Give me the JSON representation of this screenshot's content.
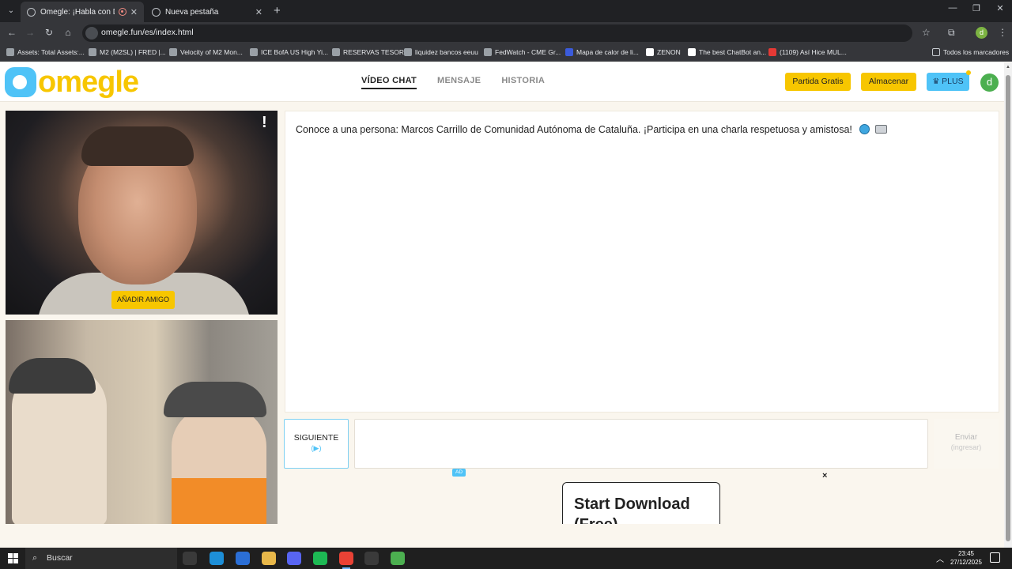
{
  "browser": {
    "tabs": [
      {
        "label": "Omegle: ¡Habla con Desconocidos!",
        "active": true
      },
      {
        "label": "Nueva pestaña",
        "active": false
      }
    ],
    "url": "omegle.fun/es/index.html",
    "profile_initial": "d",
    "bookmarks": [
      {
        "label": "Assets: Total Assets:..."
      },
      {
        "label": "M2 (M2SL) | FRED |..."
      },
      {
        "label": "Velocity of M2 Mon..."
      },
      {
        "label": "ICE BofA US High Yi..."
      },
      {
        "label": "RESERVAS TESORO"
      },
      {
        "label": "liquidez bancos eeuu"
      },
      {
        "label": "FedWatch - CME Gr..."
      },
      {
        "label": "Mapa de calor de li..."
      },
      {
        "label": "ZENON"
      },
      {
        "label": "The best ChatBot an..."
      },
      {
        "label": "(1109) Así Hice MUL..."
      }
    ],
    "all_bookmarks_label": "Todos los marcadores"
  },
  "site": {
    "logo_text": "omegle",
    "nav": [
      {
        "label": "VÍDEO CHAT",
        "active": true
      },
      {
        "label": "MENSAJE",
        "active": false
      },
      {
        "label": "HISTORIA",
        "active": false
      }
    ],
    "buttons": {
      "free_match": "Partida Gratis",
      "store": "Almacenar",
      "plus": "PLUS"
    },
    "user_initial": "d"
  },
  "video": {
    "report_glyph": "!",
    "add_friend": "AÑADIR AMIGO"
  },
  "chat": {
    "message": "Conoce a una persona: Marcos Carrillo de Comunidad Autónoma de Cataluña. ¡Participa en una charla respetuosa y amistosa!",
    "next_label": "SIGUIENTE",
    "next_hint": "(▶)",
    "input_value": "",
    "send_label": "Enviar",
    "send_hint": "(ingresar)"
  },
  "ad": {
    "badge": "AD",
    "close": "×",
    "title": "Start Download",
    "subtitle": "(Free)"
  },
  "taskbar": {
    "search_label": "Buscar",
    "time": "23:45",
    "date": "27/12/2025",
    "apps": [
      {
        "name": "task-view-icon",
        "color": "#3a3a3a"
      },
      {
        "name": "edge-icon",
        "color": "#1d8fd8"
      },
      {
        "name": "store-icon",
        "color": "#2b6fd6"
      },
      {
        "name": "explorer-icon",
        "color": "#e8b84a"
      },
      {
        "name": "discord-icon",
        "color": "#5865f2"
      },
      {
        "name": "spotify-icon",
        "color": "#1db954"
      },
      {
        "name": "chrome-icon",
        "color": "#e94235"
      },
      {
        "name": "recorder-icon",
        "color": "#3a3a3a"
      },
      {
        "name": "vpn-icon",
        "color": "#4caf50"
      }
    ]
  }
}
